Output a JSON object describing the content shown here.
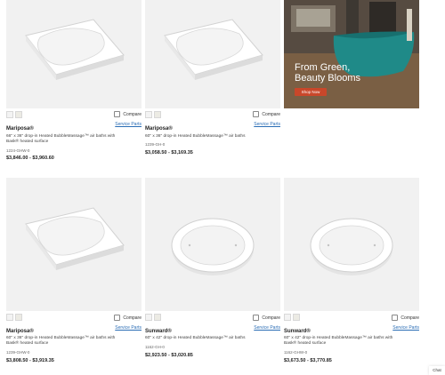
{
  "promo": {
    "headline_line1": "From Green,",
    "headline_line2": "Beauty Blooms",
    "button": "Shop Now"
  },
  "common": {
    "compare": "Compare",
    "service_parts": "Service Parts"
  },
  "products": [
    {
      "name": "Mariposa®",
      "desc": "66\" x 36\" drop-in Heated BubbleMassage™ air baths with Bask® heated surface",
      "sku": "1224-GHW-0",
      "price": "$3,846.00 - $3,960.60",
      "tub": "rect"
    },
    {
      "name": "Mariposa®",
      "desc": "60\" x 36\" drop-in Heated BubbleMassage™ air baths",
      "sku": "1239-GH-0",
      "price": "$3,058.50 - $3,169.35",
      "tub": "rect"
    },
    {
      "name": "Mariposa®",
      "desc": "60\" x 36\" drop-in Heated BubbleMassage™ air baths with Bask® heated surface",
      "sku": "1239-GHW-0",
      "price": "$3,808.50 - $3,919.35",
      "tub": "rect"
    },
    {
      "name": "Sunward®",
      "desc": "60\" x 42\" drop-in Heated BubbleMassage™ air baths",
      "sku": "1162-GH-0",
      "price": "$2,923.50 - $3,020.85",
      "tub": "oval"
    },
    {
      "name": "Sunward®",
      "desc": "60\" x 42\" drop-in Heated BubbleMassage™ air baths with Bask® heated surface",
      "sku": "1162-GHW-0",
      "price": "$3,673.50 - $3,770.85",
      "tub": "oval"
    }
  ],
  "chat": "Chat"
}
